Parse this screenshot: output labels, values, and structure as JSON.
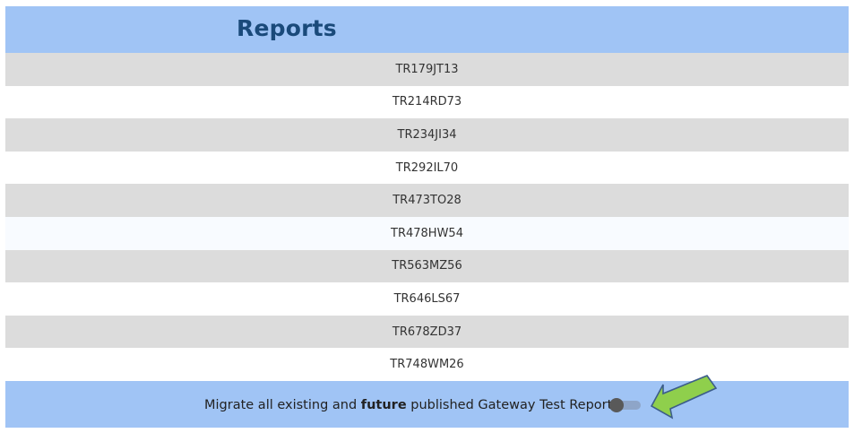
{
  "header": {
    "title": "Reports"
  },
  "reports": [
    "TR179JT13",
    "TR214RD73",
    "TR234JI34",
    "TR292IL70",
    "TR473TO28",
    "TR478HW54",
    "TR563MZ56",
    "TR646LS67",
    "TR678ZD37",
    "TR748WM26"
  ],
  "footer": {
    "msg_before": "Migrate all existing and ",
    "msg_bold": "future",
    "msg_after": " published Gateway Test Reports",
    "toggle_state": "off"
  },
  "colors": {
    "header_bg": "#a0c4f5",
    "title": "#1a4a7a",
    "row_alt": "#dcdcdc",
    "arrow_fill": "#8fcf4c",
    "arrow_stroke": "#3c5d8a"
  }
}
